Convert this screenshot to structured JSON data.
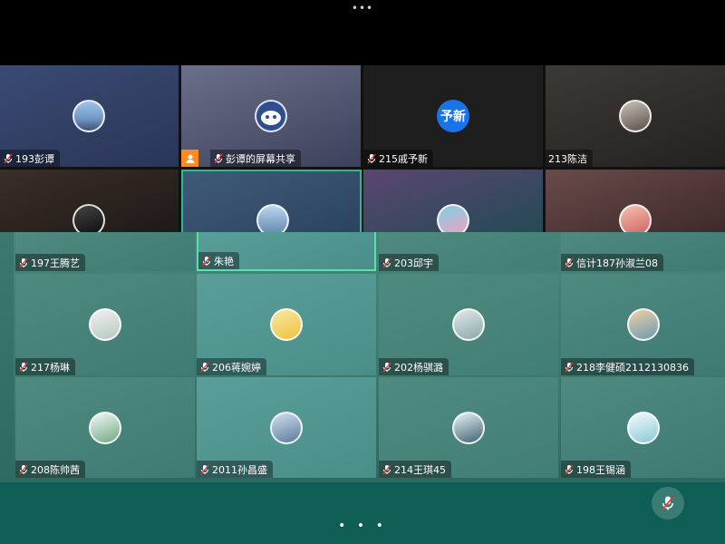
{
  "top_menu": "•••",
  "tiles_top": [
    {
      "name": "193彭谭"
    },
    {
      "name": "彭谭的屏幕共享"
    },
    {
      "name": "215戚予新"
    },
    {
      "name": "213陈洁"
    }
  ],
  "tiles": [
    {
      "name": "197王腾艺"
    },
    {
      "name": "朱艳"
    },
    {
      "name": "203邱宇"
    },
    {
      "name": "信计187孙淑兰08"
    },
    {
      "name": "217杨琳"
    },
    {
      "name": "206蒋婉婷"
    },
    {
      "name": "202杨骐潞"
    },
    {
      "name": "218李健硕2112130836"
    },
    {
      "name": "208陈帅茜"
    },
    {
      "name": "2011孙昌盛"
    },
    {
      "name": "214王琪45"
    },
    {
      "name": "198王锡涵"
    }
  ],
  "avatar_text": "予新",
  "page_indicator": "• • •",
  "colors": {
    "accent": "#2fb88f",
    "share_badge": "#ff8a1f",
    "bottom_bar": "#0f5e55",
    "avatar_blue": "#1a73e8"
  }
}
